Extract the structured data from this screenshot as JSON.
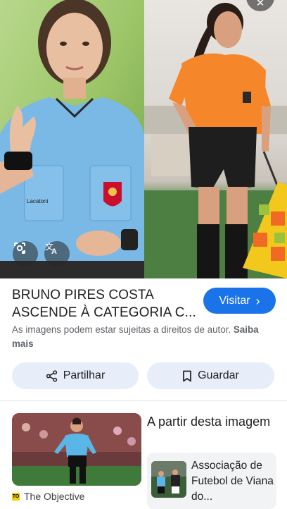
{
  "hero": {
    "lens_button": "lens-icon",
    "translate_button": "translate-icon",
    "close_button": "close-icon",
    "shirt_brand": "Lacatoni"
  },
  "result": {
    "title": "BRUNO PIRES COSTA ASCENDE À CATEGORIA C...",
    "visit_label": "Visitar",
    "copyright_text": "As imagens podem estar sujeitas a direitos de autor.",
    "learn_more": "Saiba mais"
  },
  "actions": {
    "share_label": "Partilhar",
    "save_label": "Guardar"
  },
  "related": {
    "source_logo_text": "TO",
    "source_name": "The Objective",
    "from_image_title": "A partir desta imagem",
    "card_title": "Associação de Futebol de Viana do..."
  },
  "colors": {
    "accent": "#1a73e8",
    "action_bg": "#e8eef9",
    "referee_blue": "#7ab8e6",
    "referee_orange": "#f5862a"
  }
}
